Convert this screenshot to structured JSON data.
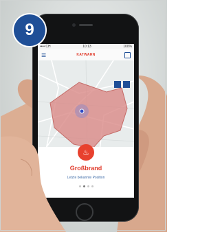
{
  "badge": {
    "number": "9"
  },
  "phone": {
    "status": {
      "carrier": "•••• CH",
      "time": "10:13",
      "battery": "100%"
    },
    "app": {
      "logo": "KATWARN",
      "menu_icon": "hamburger-icon",
      "info_icon": "info-icon"
    },
    "alert": {
      "title": "Großbrand",
      "subtitle": "Letzte bekannte Position",
      "icon": "fire-icon"
    },
    "pager": {
      "count": 4,
      "active_index": 1
    }
  },
  "colors": {
    "badge": "#1f4f97",
    "alert": "#e8412e",
    "zone": "#d98a87"
  }
}
